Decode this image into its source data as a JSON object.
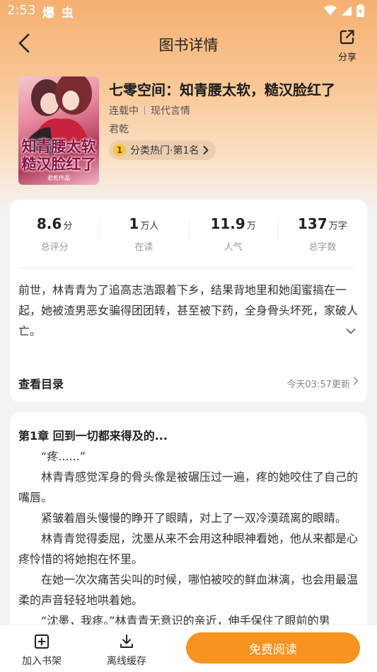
{
  "status_bar": {
    "time": "2:53",
    "extra": "爆 虫"
  },
  "nav": {
    "title": "图书详情",
    "share_label": "分享"
  },
  "book": {
    "title": "七零空间：知青腰太软，糙汉脸红了",
    "status": "连载中",
    "category": "现代言情",
    "author": "君乾",
    "rank_number": "1",
    "rank_text": "分类热门·第1名",
    "cover_title": "知青腰太软 糙汉脸红了",
    "cover_author": "君乾作品"
  },
  "stats": [
    {
      "value": "8.6",
      "unit": "分",
      "label": "总评分"
    },
    {
      "value": "1",
      "unit": "万人",
      "label": "在读"
    },
    {
      "value": "11.9",
      "unit": "万",
      "label": "人气"
    },
    {
      "value": "137",
      "unit": "万字",
      "label": "总字数"
    }
  ],
  "synopsis": "前世，林青青为了追高志浩跟着下乡，结果背地里和她闺蜜搞在一起，她被渣男恶女骗得团团转，甚至被下药，全身骨头坏死，家破人亡。",
  "toc": {
    "label": "查看目录",
    "update": "今天03:57更新"
  },
  "preview": {
    "chapter_title": "第1章 回到一切都来得及的...",
    "paragraphs": [
      "“疼......”",
      "林青青感觉浑身的骨头像是被碾压过一遍，疼的她咬住了自己的嘴唇。",
      "紧皱着眉头慢慢的睁开了眼睛，对上了一双冷漠疏离的眼睛。",
      "林青青觉得委屈，沈墨从来不会用这种眼神看她，他从来都是心疼怜惜的将她抱在怀里。",
      "在她一次次痛苦尖叫的时候，哪怕被咬的鲜血淋漓，也会用最温柔的声音轻轻地哄着她。",
      "“沈墨，我疼。”林青青无意识的亲近，伸手保住了眼前的男"
    ]
  },
  "bottom": {
    "add_shelf": "加入书架",
    "offline": "离线缓存",
    "read": "免费阅读"
  },
  "colors": {
    "accent": "#f7931e",
    "rank_badge": "#f5c646"
  }
}
